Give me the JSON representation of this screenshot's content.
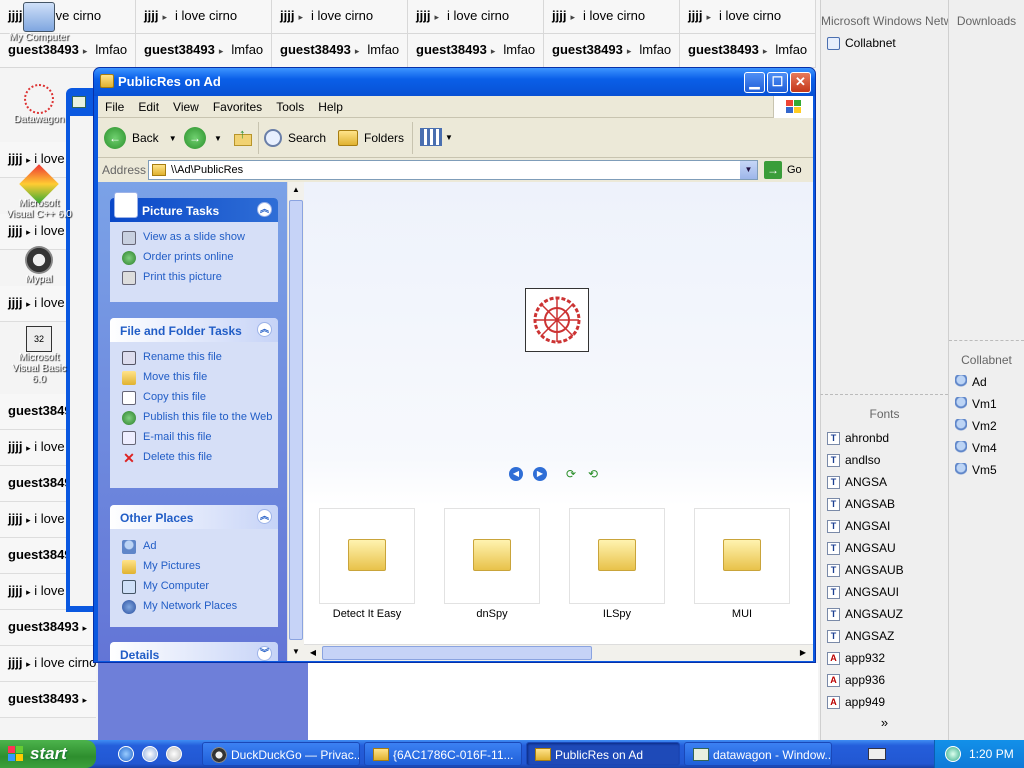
{
  "background": {
    "tile_top_name": "jjjj",
    "tile_top_text": "i love cirno",
    "tile_bottom_name": "guest38493",
    "tile_bottom_text": "lmfao",
    "left_name": "jjjj",
    "left_text": "i love cirno",
    "left_guest": "guest38493"
  },
  "network_panel": {
    "title": "Microsoft Windows Network",
    "items": [
      "Collabnet"
    ]
  },
  "downloads_panel": {
    "title": "Downloads"
  },
  "collabnet_panel": {
    "title": "Collabnet",
    "items": [
      "Ad",
      "Vm1",
      "Vm2",
      "Vm4",
      "Vm5"
    ]
  },
  "fonts_panel": {
    "title": "Fonts",
    "items": [
      "ahronbd",
      "andlso",
      "ANGSA",
      "ANGSAB",
      "ANGSAI",
      "ANGSAU",
      "ANGSAUB",
      "ANGSAUI",
      "ANGSAUZ",
      "ANGSAZ",
      "app932",
      "app936",
      "app949"
    ],
    "more": "»"
  },
  "desktop_icons": [
    "My Computer",
    "Datawagon",
    "Microsoft Visual C++ 6.0",
    "Mypal",
    "Microsoft Visual Basic 6.0"
  ],
  "window": {
    "title": "PublicRes on Ad",
    "menu": [
      "File",
      "Edit",
      "View",
      "Favorites",
      "Tools",
      "Help"
    ],
    "toolbar": {
      "back": "Back",
      "search": "Search",
      "folders": "Folders"
    },
    "address_label": "Address",
    "address_value": "\\\\Ad\\PublicRes",
    "go_label": "Go",
    "picture_tasks": {
      "title": "Picture Tasks",
      "items": [
        "View as a slide show",
        "Order prints online",
        "Print this picture"
      ]
    },
    "file_tasks": {
      "title": "File and Folder Tasks",
      "items": [
        "Rename this file",
        "Move this file",
        "Copy this file",
        "Publish this file to the Web",
        "E-mail this file",
        "Delete this file"
      ]
    },
    "other_places": {
      "title": "Other Places",
      "items": [
        "Ad",
        "My Pictures",
        "My Computer",
        "My Network Places"
      ]
    },
    "details": {
      "title": "Details"
    },
    "folders": [
      "Detect It Easy",
      "dnSpy",
      "ILSpy",
      "MUI"
    ]
  },
  "taskbar": {
    "start": "start",
    "buttons": [
      "DuckDuckGo — Privac...",
      "{6AC1786C-016F-11...",
      "PublicRes on Ad",
      "datawagon - Window..."
    ],
    "clock": "1:20 PM"
  },
  "colors": {
    "title_blue": "#0a5fe8",
    "start_green": "#2e8e2e",
    "task_link": "#215dc6"
  }
}
